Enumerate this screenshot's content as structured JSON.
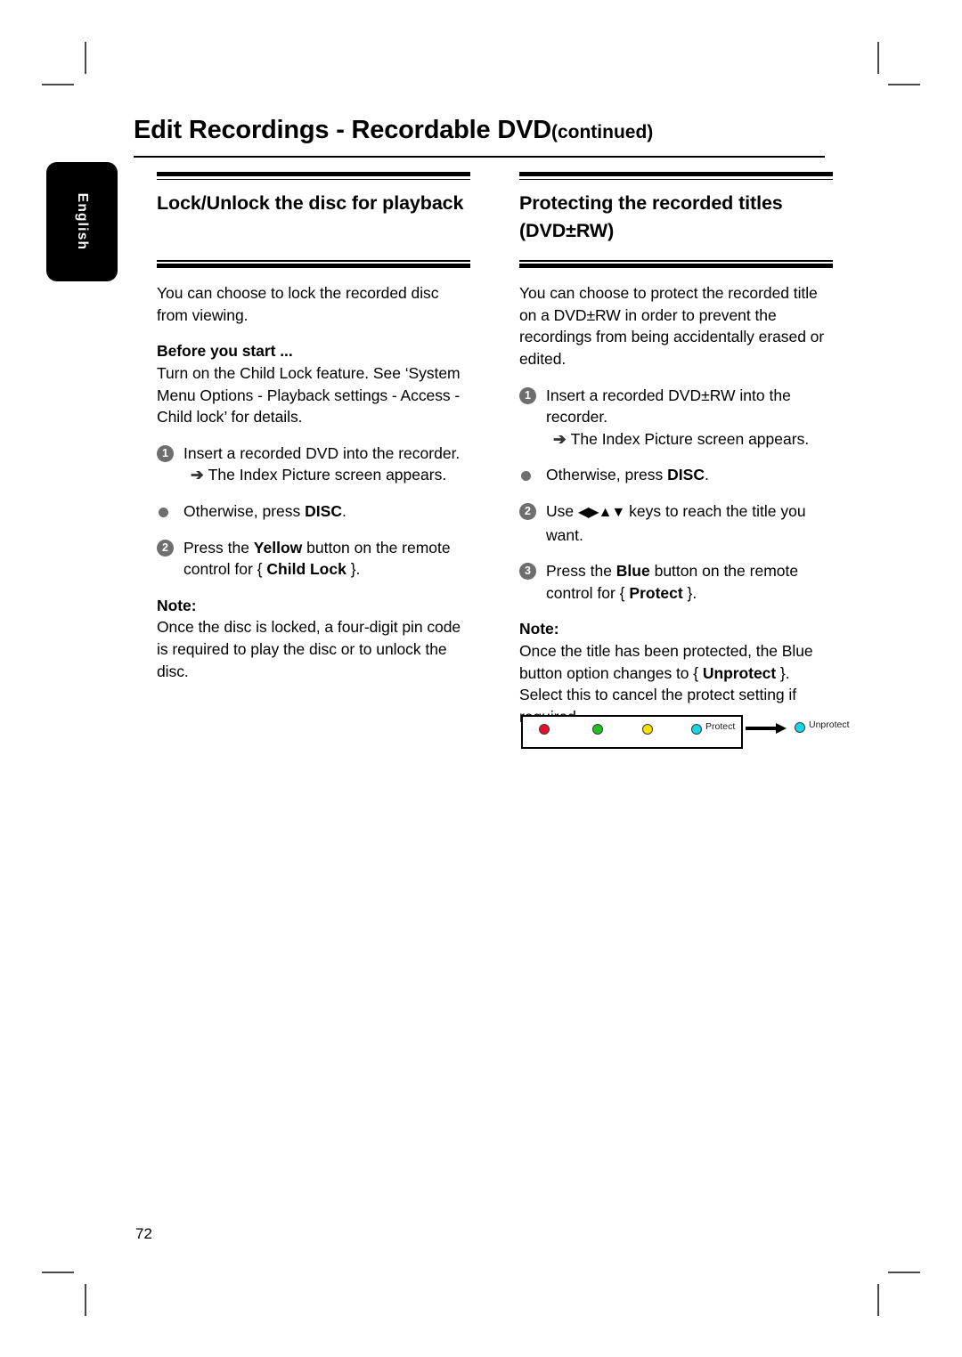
{
  "page": {
    "title_main": "Edit Recordings - Recordable DVD",
    "title_suffix": "(continued)",
    "language_tab": "English",
    "page_number": "72"
  },
  "left_column": {
    "heading": "Lock/Unlock the disc for playback",
    "intro": "You can choose to lock the recorded disc from viewing.",
    "before_you_start_label": "Before you start ...",
    "before_you_start_body": "Turn on the Child Lock feature.  See ‘System Menu Options - Playback settings - Access - Child lock’ for details.",
    "step1_number": "1",
    "step1_text": "Insert a recorded DVD into the recorder.",
    "step1_result_arrow": "➔",
    "step1_result": "The Index Picture screen appears.",
    "bullet_prefix": "Otherwise, press ",
    "bullet_bold": "DISC",
    "bullet_suffix": ".",
    "step2_number": "2",
    "step2_pre": "Press the ",
    "step2_bold1": "Yellow",
    "step2_mid": " button on the remote control for { ",
    "step2_bold2": "Child Lock",
    "step2_post": " }.",
    "note_label": "Note:",
    "note_body": "Once the disc is locked, a four-digit pin code is required to play the disc or to unlock the disc."
  },
  "right_column": {
    "heading": "Protecting the recorded titles (DVD±RW)",
    "intro": "You can choose to protect the recorded title on a DVD±RW in order to prevent the recordings from being accidentally erased or edited.",
    "step1_number": "1",
    "step1_text": "Insert a recorded DVD±RW into the recorder.",
    "step1_result_arrow": "➔",
    "step1_result": "The Index Picture screen appears.",
    "bullet_prefix": "Otherwise, press ",
    "bullet_bold": "DISC",
    "bullet_suffix": ".",
    "step2_number": "2",
    "step2_pre": "Use ",
    "step2_keys": "◀▶▲▼",
    "step2_post": " keys to reach the title you want.",
    "step3_number": "3",
    "step3_pre": "Press the ",
    "step3_bold1": "Blue",
    "step3_mid": " button on the remote control for { ",
    "step3_bold2": "Protect",
    "step3_post": " }.",
    "note_label": "Note:",
    "note_pre": "Once the title has been protected, the Blue button option changes to { ",
    "note_bold": "Unprotect",
    "note_post": " }.  Select this to cancel the protect setting if required."
  },
  "illustration": {
    "protect_label": "Protect",
    "unprotect_label": "Unprotect",
    "dot_colors": {
      "red": "#e8112d",
      "green": "#21c021",
      "yellow": "#f5e000",
      "cyan": "#14d6e8"
    }
  }
}
